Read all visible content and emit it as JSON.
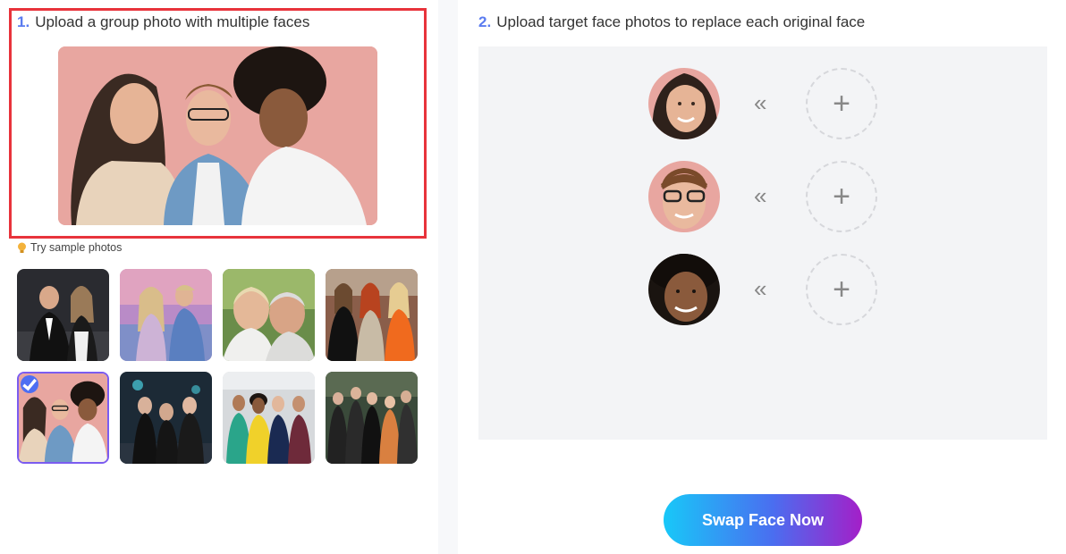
{
  "step1": {
    "number": "1.",
    "title": "Upload a group photo with multiple faces"
  },
  "sample_link": "Try sample photos",
  "step2": {
    "number": "2.",
    "title": "Upload target face photos to replace each original face"
  },
  "face_rows": [
    {
      "arrow": "«",
      "add": "+"
    },
    {
      "arrow": "«",
      "add": "+"
    },
    {
      "arrow": "«",
      "add": "+"
    }
  ],
  "swap_button": "Swap Face Now",
  "colors": {
    "accent": "#5b7cf0",
    "highlight_border": "#e8333b",
    "panel_bg": "#f3f4f6"
  }
}
